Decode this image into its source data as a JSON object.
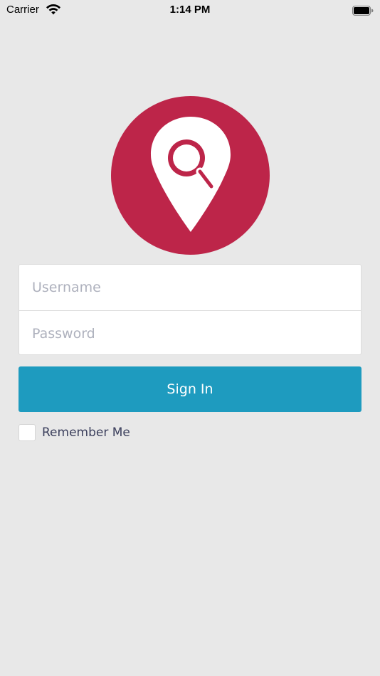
{
  "status_bar": {
    "carrier": "Carrier",
    "time": "1:14 PM",
    "wifi_icon": "wifi-icon",
    "battery_icon": "battery-icon"
  },
  "logo": {
    "icon": "location-search-pin-icon",
    "circle_color": "#bd2549",
    "pin_color": "#ffffff"
  },
  "form": {
    "username_placeholder": "Username",
    "username_value": "",
    "password_placeholder": "Password",
    "password_value": ""
  },
  "sign_in": {
    "label": "Sign In",
    "color": "#1e9bbf"
  },
  "remember_me": {
    "label": "Remember Me",
    "checked": false
  },
  "colors": {
    "background": "#e8e8e8",
    "placeholder": "#aeb1bd",
    "label_text": "#3b3f5c"
  }
}
